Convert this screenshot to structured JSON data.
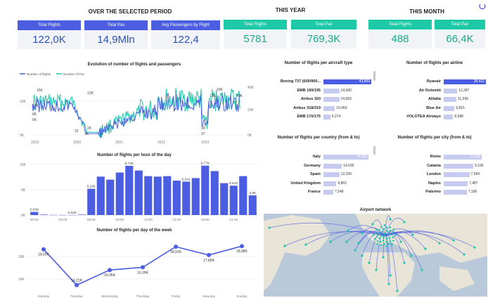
{
  "colors": {
    "blue": "#4b5de0",
    "teal": "#1ec9a7",
    "blue_text": "#2f52b8",
    "teal_text": "#1aa98c",
    "light_bar": "#c7cbef",
    "map_water": "#b9c9d9",
    "map_land": "#e8e4d8"
  },
  "sections": {
    "selected_period": "OVER THE SELECTED PERIOD",
    "this_year": "THIS YEAR",
    "this_month": "THIS MONTH"
  },
  "kpis": {
    "period": [
      {
        "label": "Total Flights",
        "value": "122,0K"
      },
      {
        "label": "Total Pax",
        "value": "14,9Mln"
      },
      {
        "label": "Avg Passengers by Flight",
        "value": "122,4"
      }
    ],
    "year": [
      {
        "label": "Total Flights",
        "value": "5781"
      },
      {
        "label": "Total Pax",
        "value": "769,3K"
      }
    ],
    "month": [
      {
        "label": "Total Flights",
        "value": "488"
      },
      {
        "label": "Total Pax",
        "value": "66,4K"
      }
    ]
  },
  "top_icon": "refresh-icon",
  "evolution": {
    "title": "Evolution of number of flights and passengers",
    "legend": [
      "Number of flights",
      "Number of Pax"
    ],
    "y_left_ticks": [
      "10K",
      "0K"
    ],
    "y_right_ticks": [
      "40K",
      "20K",
      "0K"
    ],
    "x_ticks": [
      "2019",
      "2020",
      "2021",
      "2022",
      "2023"
    ],
    "labels": [
      "15K",
      "13K",
      "10K",
      "8K",
      "6K",
      "23",
      "2K",
      "19K",
      "13K",
      "3K",
      "37",
      "3K",
      "40K"
    ]
  },
  "chart_data": [
    {
      "type": "bar",
      "title": "Number of flights per hour of the day",
      "categories": [
        "00:00",
        "01:00",
        "02:00",
        "03:00",
        "04:00",
        "05:00",
        "06:00",
        "07:00",
        "08:00",
        "09:00",
        "10:00",
        "11:00",
        "12:00",
        "13:00",
        "14:00",
        "15:00",
        "16:00",
        "17:00",
        "18:00",
        "19:00",
        "20:00",
        "21:00",
        "22:00",
        "23:00"
      ],
      "values": [
        0.63,
        0.1,
        0.03,
        0.02,
        0.02,
        0.1,
        5.19,
        7.6,
        7.0,
        8.4,
        9.72,
        8.8,
        7.7,
        7.6,
        7.7,
        6.8,
        6.61,
        7.3,
        9.77,
        8.7,
        6.3,
        5.81,
        7.7,
        3.9
      ],
      "data_labels": {
        "0": "0,63K",
        "4": "0,02K",
        "6": "5,19K",
        "10": "9,72K",
        "16": "6,61K",
        "18": "9,77K",
        "21": "5,81K",
        "23": "3,9K"
      },
      "x_ticks": [
        "00:00",
        "03:00",
        "06:00",
        "09:00",
        "12:00",
        "15:00",
        "18:00",
        "21:00"
      ],
      "y_ticks": [
        "10K",
        "5K",
        "0K"
      ],
      "ylim": [
        0,
        10
      ]
    },
    {
      "type": "line",
      "title": "Number of flights per day of the week",
      "categories": [
        "Monday",
        "Tuesday",
        "Wednesday",
        "Thursday",
        "Friday",
        "Saturday",
        "Sunday"
      ],
      "values": [
        18.59,
        14.21,
        16.05,
        16.39,
        18.91,
        17.89,
        18.98
      ],
      "data_labels": [
        "18,59K",
        "14,21K",
        "16,05K",
        "16,39K",
        "18,91K",
        "17,89K",
        "18,98K"
      ],
      "y_ticks": [
        "18K",
        "16K",
        "14K"
      ],
      "ylim": [
        13.4,
        19.6
      ]
    },
    {
      "type": "bar",
      "title": "Number of flights per aircraft type",
      "categories": [
        "Boeing 737 (600/900...",
        "EMB 190/195",
        "Airbus 320",
        "Airbus 318/319",
        "EMB 170/175"
      ],
      "values": [
        43899,
        14580,
        14583,
        10459,
        6274
      ],
      "data_labels": [
        "43,899",
        "14,580",
        "14,583",
        "10,459",
        "6,274"
      ]
    },
    {
      "type": "bar",
      "title": "Number of flights per airline",
      "categories": [
        "Ryanair",
        "Air Dolomiti",
        "Alitalia",
        "Blue Air",
        "VOLOTEA Airways"
      ],
      "values": [
        38432,
        12287,
        11596,
        9815,
        8588
      ],
      "data_labels": [
        "38,432",
        "12,287",
        "11,596",
        "9,815",
        "8,588"
      ]
    },
    {
      "type": "bar",
      "title": "Number of flights per country (from & to)",
      "categories": [
        "Italy",
        "Germany",
        "Spain",
        "United Kingdom",
        "France"
      ],
      "values": [
        34299,
        14035,
        12200,
        9862,
        7548
      ],
      "data_labels": [
        "34,299",
        "14,035",
        "12,200",
        "9,862",
        "7,548"
      ]
    },
    {
      "type": "bar",
      "title": "Number of flights per city (from & to)",
      "categories": [
        "Rome",
        "Catania",
        "London",
        "Naples",
        "Palermo"
      ],
      "values": [
        11822,
        9195,
        7994,
        7487,
        7186
      ],
      "data_labels": [
        "11,822",
        "9,195",
        "7,994",
        "7,487",
        "7,186"
      ]
    }
  ],
  "map": {
    "title": "Airport network"
  }
}
